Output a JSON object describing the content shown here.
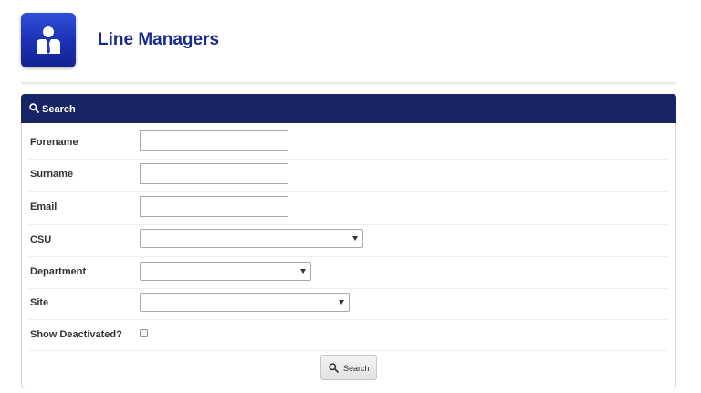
{
  "header": {
    "title": "Line Managers",
    "logo_icon": "user-badge-icon",
    "accent_color": "#1c2a8e"
  },
  "search_panel": {
    "title": "Search",
    "header_icon": "search-icon",
    "header_color": "#192466",
    "fields": {
      "forename": {
        "label": "Forename",
        "value": ""
      },
      "surname": {
        "label": "Surname",
        "value": ""
      },
      "email": {
        "label": "Email",
        "value": ""
      },
      "csu": {
        "label": "CSU",
        "selected": ""
      },
      "department": {
        "label": "Department",
        "selected": ""
      },
      "site": {
        "label": "Site",
        "selected": ""
      },
      "show_deactivated": {
        "label": "Show Deactivated?",
        "checked": false
      }
    },
    "submit_label": "Search"
  }
}
